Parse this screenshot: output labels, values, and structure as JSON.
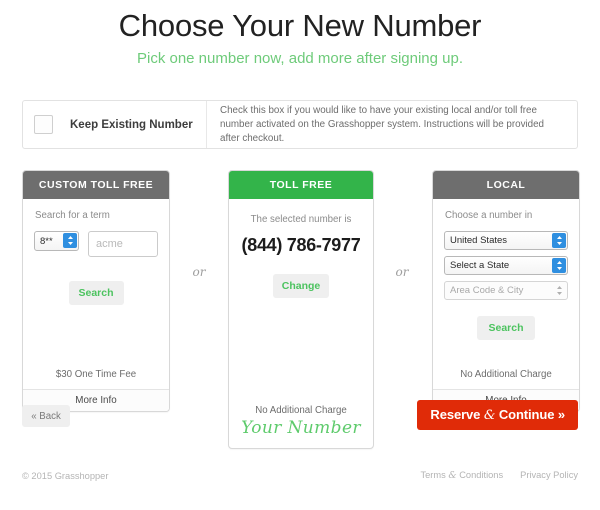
{
  "header": {
    "title": "Choose Your New Number",
    "subtitle": "Pick one number now, add more after signing up.",
    "subtitle_color": "#6ecb7a"
  },
  "keep_existing": {
    "checkbox_label": "Keep Existing Number",
    "checkbox_checked": false,
    "description": "Check this box if you would like to have your existing local and/or toll free number activated on the Grasshopper system. Instructions will be provided after checkout."
  },
  "separators": {
    "or": "or"
  },
  "cards": {
    "custom_toll_free": {
      "heading": "CUSTOM TOLL FREE",
      "heading_bg": "#6e6e6e",
      "field_label": "Search for a term",
      "prefix_value": "8**",
      "term_placeholder": "acme",
      "term_value": "",
      "search_label": "Search",
      "fee_note": "$30 One Time Fee",
      "more_info": "More Info"
    },
    "toll_free": {
      "heading": "TOLL FREE",
      "heading_bg": "#33b44a",
      "caption": "The selected number is",
      "number": "(844) 786-7977",
      "change_label": "Change",
      "fee_note": "No Additional Charge",
      "script_note": "Your Number"
    },
    "local": {
      "heading": "LOCAL",
      "heading_bg": "#6e6e6e",
      "field_label": "Choose a number in",
      "country_value": "United States",
      "state_value": "Select a State",
      "area_code_placeholder": "Area Code & City",
      "search_label": "Search",
      "fee_note": "No Additional Charge",
      "more_info": "More Info"
    }
  },
  "actions": {
    "back_label": "« Back",
    "reserve_label_before": "Reserve ",
    "reserve_amp": "&",
    "reserve_label_after": " Continue »",
    "reserve_color": "#e02b08"
  },
  "footer": {
    "copyright": "© 2015 Grasshopper",
    "terms_before": "Terms ",
    "terms_amp": "&",
    "terms_after": " Conditions",
    "privacy": "Privacy Policy"
  }
}
